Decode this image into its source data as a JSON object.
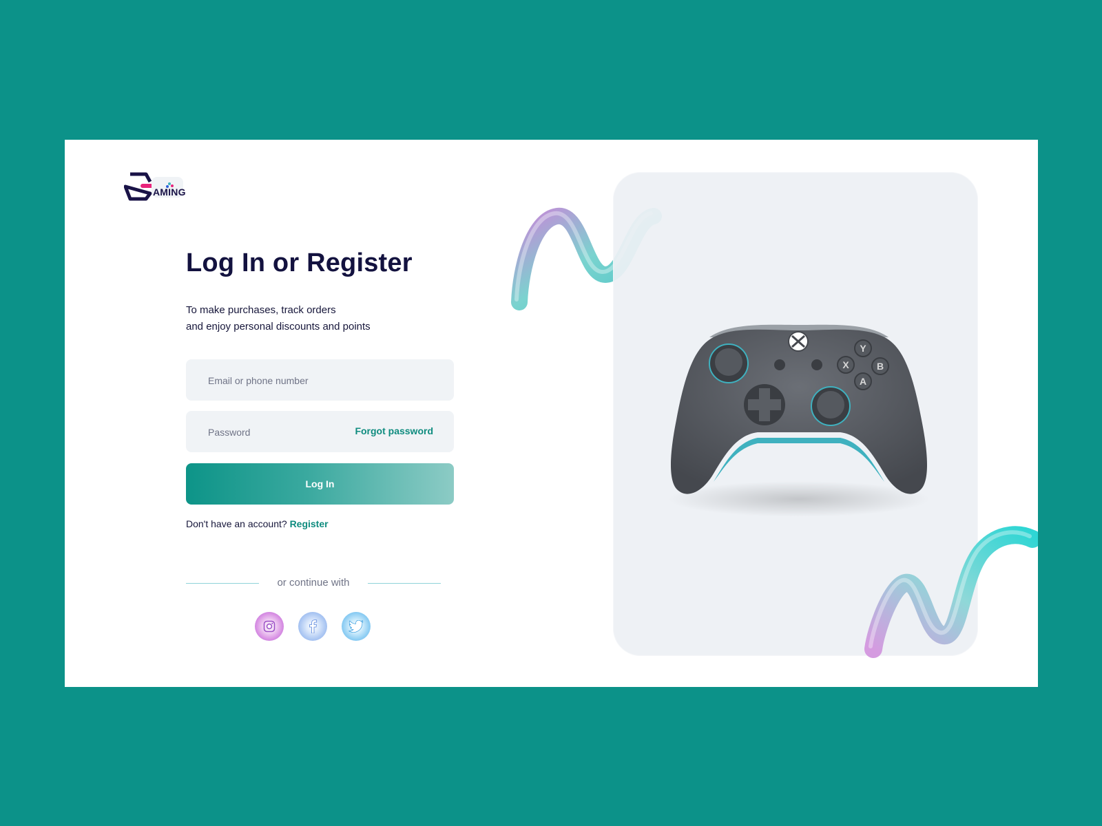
{
  "brand": {
    "name": "AMING",
    "accent": "#e8237b",
    "dark": "#1a1347"
  },
  "theme": {
    "background": "#0c9289",
    "primary": "#0f8c7f",
    "field_bg": "#f0f3f6"
  },
  "form": {
    "title": "Log In or Register",
    "subtitle_line1": "To make purchases, track orders",
    "subtitle_line2": "and enjoy personal discounts and points",
    "email_placeholder": "Email or phone number",
    "password_placeholder": "Password",
    "forgot_label": "Forgot password",
    "login_label": "Log In",
    "no_account_text": "Don't have an account?",
    "register_label": "Register",
    "divider_text": "or continue with"
  },
  "social": [
    {
      "icon": "instagram-icon"
    },
    {
      "icon": "facebook-icon"
    },
    {
      "icon": "twitter-icon"
    }
  ],
  "hero": {
    "image": "gamepad-controller",
    "controller_color": "#5b5f66",
    "trim_color": "#3fb1bf"
  }
}
